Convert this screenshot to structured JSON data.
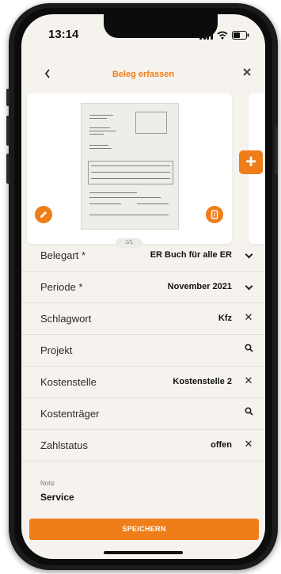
{
  "status": {
    "time": "13:14"
  },
  "header": {
    "title": "Beleg erfassen"
  },
  "card": {
    "pager": "1/1"
  },
  "fields": [
    {
      "label": "Belegart *",
      "value": "ER Buch für alle ER",
      "action": "chevron-down"
    },
    {
      "label": "Periode *",
      "value": "November 2021",
      "action": "chevron-down"
    },
    {
      "label": "Schlagwort",
      "value": "Kfz",
      "action": "clear"
    },
    {
      "label": "Projekt",
      "value": "",
      "action": "search"
    },
    {
      "label": "Kostenstelle",
      "value": "Kostenstelle 2",
      "action": "clear"
    },
    {
      "label": "Kostenträger",
      "value": "",
      "action": "search"
    },
    {
      "label": "Zahlstatus",
      "value": "offen",
      "action": "clear"
    }
  ],
  "note": {
    "label": "Notiz",
    "value": "Service"
  },
  "save_label": "SPEICHERN",
  "colors": {
    "accent": "#ef7d1a",
    "background": "#f6f3ef",
    "card": "#ffffff"
  },
  "icons": {
    "back": "chevron-left-icon",
    "close": "close-icon",
    "edit": "pencil-icon",
    "delete": "trash-icon",
    "add": "plus-icon"
  }
}
